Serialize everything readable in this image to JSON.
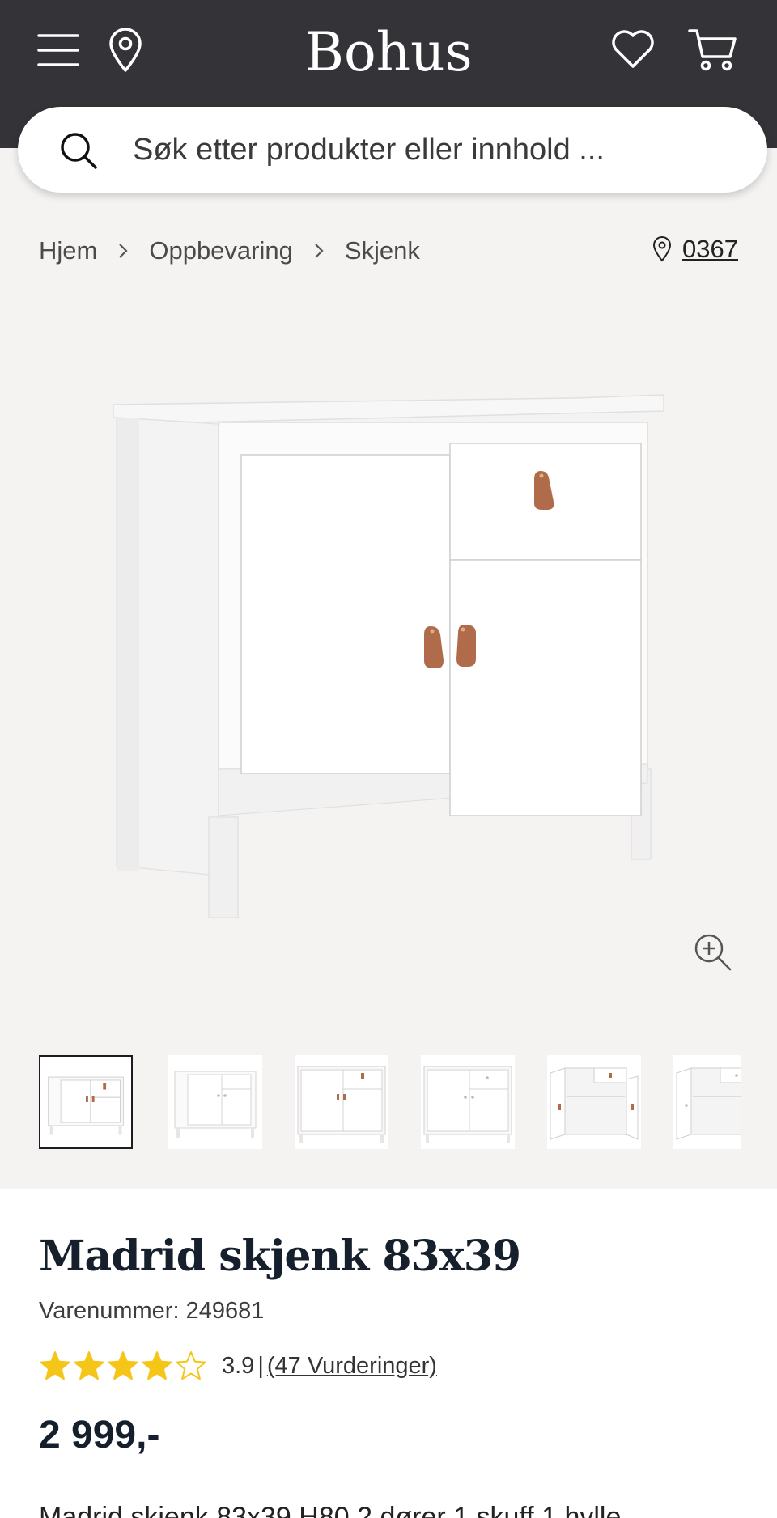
{
  "header": {
    "logo_text": "Bohus",
    "icons": [
      "menu-icon",
      "location-pin-icon",
      "heart-icon",
      "cart-icon"
    ],
    "background_color": "#333338"
  },
  "search": {
    "placeholder": "Søk etter produkter eller innhold ..."
  },
  "breadcrumb": {
    "items": [
      "Hjem",
      "Oppbevaring",
      "Skjenk"
    ]
  },
  "store": {
    "number": "0367"
  },
  "gallery": {
    "thumbnail_count_visible": 6,
    "active_index": 0
  },
  "product": {
    "title": "Madrid skjenk 83x39",
    "sku_label": "Varenummer: 249681",
    "rating_value": "3.9",
    "rating_separator": "|",
    "reviews_label": "(47 Vurderinger)",
    "rating_stars": 3.9,
    "rating_max": 5,
    "star_color": "#f5c518",
    "price": "2 999,-",
    "description_start": "Madrid skjenk 83x39 H80 2 dører 1 skuff 1 hylle"
  }
}
